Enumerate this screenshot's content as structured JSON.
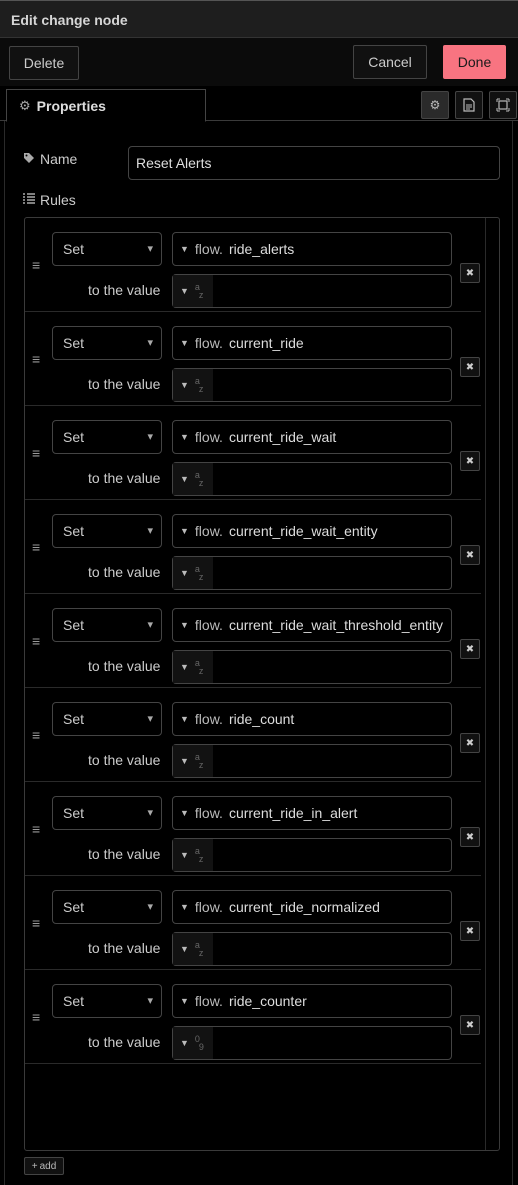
{
  "window": {
    "title": "Edit change node"
  },
  "toolbar": {
    "delete_label": "Delete",
    "cancel_label": "Cancel",
    "done_label": "Done",
    "done_color": "#f87481"
  },
  "tabs": {
    "properties_label": "Properties"
  },
  "form": {
    "name_label": "Name",
    "name_value": "Reset Alerts",
    "rules_label": "Rules",
    "to_value_label": "to the value",
    "add_label": "add"
  },
  "rules": [
    {
      "action": "Set",
      "scope": "flow.",
      "property": "ride_alerts",
      "value_type": "string",
      "value_type_top": "a",
      "value_type_bottom": "z",
      "value": ""
    },
    {
      "action": "Set",
      "scope": "flow.",
      "property": "current_ride",
      "value_type": "string",
      "value_type_top": "a",
      "value_type_bottom": "z",
      "value": ""
    },
    {
      "action": "Set",
      "scope": "flow.",
      "property": "current_ride_wait",
      "value_type": "string",
      "value_type_top": "a",
      "value_type_bottom": "z",
      "value": ""
    },
    {
      "action": "Set",
      "scope": "flow.",
      "property": "current_ride_wait_entity",
      "value_type": "string",
      "value_type_top": "a",
      "value_type_bottom": "z",
      "value": ""
    },
    {
      "action": "Set",
      "scope": "flow.",
      "property": "current_ride_wait_threshold_entity",
      "value_type": "string",
      "value_type_top": "a",
      "value_type_bottom": "z",
      "value": ""
    },
    {
      "action": "Set",
      "scope": "flow.",
      "property": "ride_count",
      "value_type": "string",
      "value_type_top": "a",
      "value_type_bottom": "z",
      "value": ""
    },
    {
      "action": "Set",
      "scope": "flow.",
      "property": "current_ride_in_alert",
      "value_type": "string",
      "value_type_top": "a",
      "value_type_bottom": "z",
      "value": ""
    },
    {
      "action": "Set",
      "scope": "flow.",
      "property": "current_ride_normalized",
      "value_type": "string",
      "value_type_top": "a",
      "value_type_bottom": "z",
      "value": ""
    },
    {
      "action": "Set",
      "scope": "flow.",
      "property": "ride_counter",
      "value_type": "number",
      "value_type_top": "0",
      "value_type_bottom": "9",
      "value": ""
    }
  ]
}
